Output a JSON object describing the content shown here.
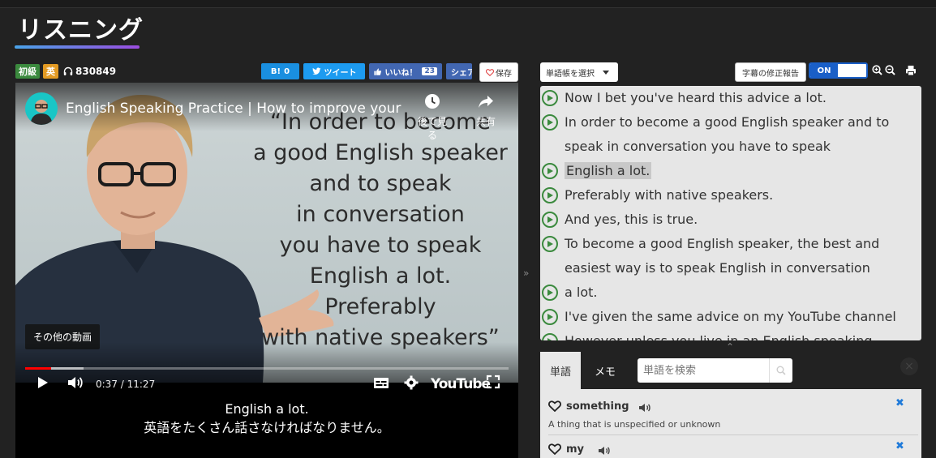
{
  "page": {
    "title": "リスニング"
  },
  "meta": {
    "level": "初級",
    "lang": "英",
    "listen_count": "830849"
  },
  "share": {
    "hatebu_label": "B!",
    "hatebu_count": "0",
    "tweet_label": "ツイート",
    "fb_like_label": "いいね！",
    "fb_like_count": "23",
    "fb_share_label": "シェア",
    "save_label": "保存"
  },
  "video": {
    "title": "English Speaking Practice | How to improve your E...",
    "watch_later_label": "後で見る",
    "share_label": "共有",
    "quote_lines": [
      "“In order to become",
      "a good English speaker",
      "and to speak",
      "in conversation",
      "you have to speak",
      "English a lot.",
      "Preferably",
      "with native speakers”"
    ],
    "more_videos_label": "その他の動画",
    "current_time": "0:37 / 11:27",
    "progress": 0.054,
    "buffered": 0.12,
    "youtube_label": "YouTube",
    "caption_en": "English a lot.",
    "caption_ja": "英語をたくさん話さなければなりません。"
  },
  "toolbar": {
    "vocab_select_label": "単語帳を選択",
    "report_label": "字幕の修正報告",
    "toggle_label": "ON"
  },
  "transcript": {
    "lines": [
      "Now I bet you've heard this advice a lot.",
      "In order to become a good English speaker and to speak in conversation you have to speak",
      "English a lot.",
      "Preferably with native speakers.",
      "And yes, this is true.",
      "To become a good English speaker, the best and easiest way is to speak English in conversation",
      "a lot.",
      "I've given the same advice on my YouTube channel",
      "However unless you live in an English speaking country"
    ],
    "active_index": 2
  },
  "vocab": {
    "tab_words": "単語",
    "tab_memo": "メモ",
    "search_placeholder": "単語を検索",
    "items": [
      {
        "word": "something",
        "definition": "A thing that is unspecified or unknown"
      },
      {
        "word": "my",
        "definition": ""
      }
    ]
  }
}
